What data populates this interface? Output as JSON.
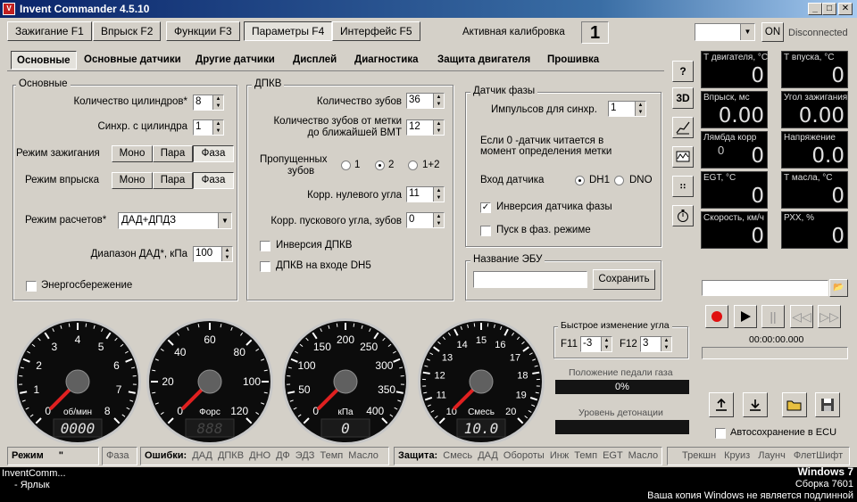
{
  "window": {
    "title": "Invent Commander 4.5.10"
  },
  "main_tabs": [
    "Зажигание F1",
    "Впрыск F2",
    "Функции F3",
    "Параметры F4",
    "Интерфейс F5"
  ],
  "active_calibration": {
    "label": "Активная калибровка",
    "value": "1"
  },
  "connection": {
    "port_value": "",
    "on_label": "ON",
    "status": "Disconnected"
  },
  "sub_tabs": [
    "Основные",
    "Основные датчики",
    "Другие датчики",
    "Дисплей",
    "Диагностика",
    "Защита двигателя",
    "Прошивка"
  ],
  "basic": {
    "title": "Основные",
    "cylinders_label": "Количество цилиндров*",
    "cylinders_value": "8",
    "sync_cyl_label": "Синхр. с цилиндра",
    "sync_cyl_value": "1",
    "ignition_mode_label": "Режим зажигания",
    "injection_mode_label": "Режим впрыска",
    "mode_options": [
      "Моно",
      "Пара",
      "Фаза"
    ],
    "calc_mode_label": "Режим расчетов*",
    "calc_mode_value": "ДАД+ДПДЗ",
    "map_range_label": "Диапазон ДАД*, кПа",
    "map_range_value": "100",
    "energy_save_label": "Энергосбережение"
  },
  "dpkv": {
    "title": "ДПКВ",
    "teeth_label": "Количество зубов",
    "teeth_value": "36",
    "teeth_tdc_label_1": "Количество зубов от метки",
    "teeth_tdc_label_2": "до ближайшей ВМТ",
    "teeth_tdc_value": "12",
    "missing_label_1": "Пропущенных",
    "missing_label_2": "зубов",
    "missing_options": [
      "1",
      "2",
      "1+2"
    ],
    "zero_angle_label": "Корр. нулевого угла",
    "zero_angle_value": "11",
    "start_angle_label": "Корр. пускового угла, зубов",
    "start_angle_value": "0",
    "invert_label": "Инверсия ДПКВ",
    "dh5_label": "ДПКВ на входе DH5"
  },
  "phase": {
    "title": "Датчик фазы",
    "pulses_label": "Импульсов для синхр.",
    "pulses_value": "1",
    "note_1": "Если 0 -датчик читается в",
    "note_2": "момент определения метки",
    "input_label": "Вход датчика",
    "input_options": [
      "DH1",
      "DNO"
    ],
    "invert_label": "Инверсия датчика фазы",
    "start_phase_label": "Пуск в фаз. режиме"
  },
  "ecu_name": {
    "title": "Название ЭБУ",
    "value": "",
    "save_label": "Сохранить"
  },
  "side_icons": [
    "?",
    "3D"
  ],
  "dashboard": [
    {
      "title": "Т двигателя, °С",
      "value": "0"
    },
    {
      "title": "Т впуска, °С",
      "value": "0"
    },
    {
      "title": "Впрыск, мс",
      "value": "0.00"
    },
    {
      "title": "Угол зажигания",
      "value": "0.00"
    },
    {
      "title": "Лямбда корр",
      "value": "0",
      "sub": "0"
    },
    {
      "title": "Напряжение",
      "value": "0.0"
    },
    {
      "title": "EGT, °С",
      "value": "0"
    },
    {
      "title": "Т масла, °С",
      "value": "0"
    },
    {
      "title": "Скорость, км/ч",
      "value": "0"
    },
    {
      "title": "РХХ, %",
      "value": "0"
    }
  ],
  "player": {
    "time": "00:00:00.000"
  },
  "gauges": [
    {
      "label": "об/мин",
      "digital": "0000",
      "ticks": [
        "0",
        "1",
        "2",
        "3",
        "4",
        "5",
        "6",
        "7",
        "8"
      ]
    },
    {
      "label": "Форс",
      "digital": "888",
      "ticks": [
        "0",
        "20",
        "40",
        "60",
        "80",
        "100",
        "120"
      ]
    },
    {
      "label": "кПа",
      "digital": "0",
      "ticks": [
        "0",
        "50",
        "100",
        "150",
        "200",
        "250",
        "300",
        "350",
        "400"
      ]
    },
    {
      "label": "Смесь",
      "digital": "10.0",
      "ticks": [
        "10",
        "11",
        "12",
        "13",
        "14",
        "15",
        "16",
        "17",
        "18",
        "19",
        "20"
      ]
    }
  ],
  "quick_angle": {
    "title": "Быстрое изменение угла",
    "f11_label": "F11",
    "f11_value": "-3",
    "f12_label": "F12",
    "f12_value": "3"
  },
  "pedal": {
    "label": "Положение педали газа",
    "value": "0%"
  },
  "knock": {
    "label": "Уровень детонации",
    "value": ""
  },
  "autosave_label": "Автосохранение в ECU",
  "status": {
    "mode_label": "Режим",
    "mode_value": "\"",
    "phase": "Фаза",
    "errors_label": "Ошибки:",
    "errors": [
      "ДАД",
      "ДПКВ",
      "ДНО",
      "ДФ",
      "ЭДЗ",
      "Темп",
      "Масло"
    ],
    "protection_label": "Защита:",
    "protection": [
      "Смесь",
      "ДАД",
      "Обороты",
      "Инж",
      "Темп",
      "EGT",
      "Масло"
    ],
    "extras": [
      "Трекшн",
      "Круиз",
      "Лаунч",
      "ФлетШифт"
    ]
  },
  "taskbar": {
    "item_1": "InventComm...",
    "item_2": "- Ярлык",
    "win_1": "Windows 7",
    "win_2": "Сборка 7601",
    "win_3": "Ваша копия Windows не является подлинной"
  }
}
